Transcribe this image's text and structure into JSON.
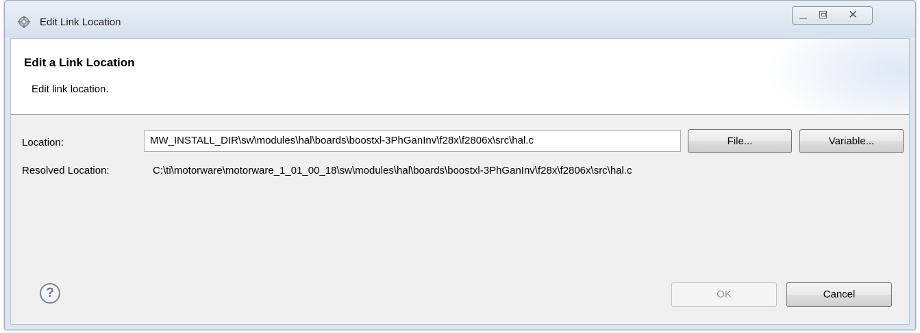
{
  "window": {
    "title": "Edit Link Location",
    "icon": "eclipse-gear-icon",
    "controls": [
      "minimize",
      "maximize",
      "close"
    ]
  },
  "banner": {
    "title": "Edit a Link Location",
    "description": "Edit link location."
  },
  "location": {
    "label": "Location:",
    "value": "MW_INSTALL_DIR\\sw\\modules\\hal\\boards\\boostxl-3PhGanInv\\f28x\\f2806x\\src\\hal.c",
    "file_button": "File...",
    "variable_button": "Variable..."
  },
  "resolved": {
    "label": "Resolved Location:",
    "value": "C:\\ti\\motorware\\motorware_1_01_00_18\\sw\\modules\\hal\\boards\\boostxl-3PhGanInv\\f28x\\f2806x\\src\\hal.c"
  },
  "footer": {
    "help_icon": "question-mark",
    "help_glyph": "?",
    "ok_button": "OK",
    "ok_enabled": false,
    "cancel_button": "Cancel"
  },
  "colors": {
    "window_frame": "#dce6f2",
    "dialog_background": "#f0f0f0",
    "banner_background": "#ffffff",
    "disabled_text": "#8f8f8f"
  }
}
